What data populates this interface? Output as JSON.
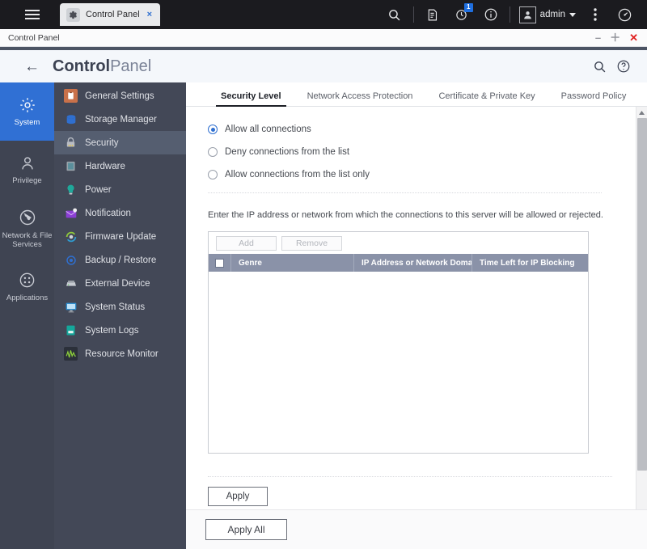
{
  "desktop": {
    "menu_icon": "hamburger-icon",
    "tab": {
      "icon": "gear-icon",
      "label": "Control Panel",
      "close": "×"
    },
    "toolbar": [
      {
        "name": "search-icon",
        "label": ""
      },
      {
        "name": "logs-icon",
        "label": ""
      },
      {
        "name": "update-sync-icon",
        "badge": "1"
      },
      {
        "name": "info-icon",
        "label": ""
      }
    ],
    "user": {
      "avatar": "user-avatar-icon",
      "name": "admin",
      "caret": "▾"
    },
    "more_icon": "vertical-dots-icon",
    "dashboard_icon": "speedometer-icon"
  },
  "window": {
    "title": "Control Panel",
    "minimize": "–",
    "maximize": "＋",
    "close": "✕"
  },
  "app_header": {
    "back": "←",
    "title_bold": "Control",
    "title_light": "Panel",
    "search_icon": "search-icon",
    "help_icon": "help-icon"
  },
  "rail": {
    "items": [
      {
        "label": "System",
        "icon": "gear-icon",
        "active": true
      },
      {
        "label": "Privilege",
        "icon": "user-icon",
        "active": false
      },
      {
        "label": "Network & File Services",
        "icon": "globe-icon",
        "active": false
      },
      {
        "label": "Applications",
        "icon": "grid-icon",
        "active": false
      }
    ]
  },
  "sidebar": {
    "items": [
      {
        "label": "General Settings",
        "icon": "clipboard-icon",
        "color": "#c9714a",
        "active": false
      },
      {
        "label": "Storage Manager",
        "icon": "database-icon",
        "color": "#2f6fd0",
        "active": false
      },
      {
        "label": "Security",
        "icon": "lock-icon",
        "color": "#b8bcc4",
        "active": true
      },
      {
        "label": "Hardware",
        "icon": "server-icon",
        "color": "#5a8f9c",
        "active": false
      },
      {
        "label": "Power",
        "icon": "power-bulb-icon",
        "color": "#1fa89a",
        "active": false
      },
      {
        "label": "Notification",
        "icon": "envelope-icon",
        "color": "#8b3fd4",
        "active": false
      },
      {
        "label": "Firmware Update",
        "icon": "refresh-icon",
        "color": "#2f9bd0",
        "active": false
      },
      {
        "label": "Backup / Restore",
        "icon": "backup-icon",
        "color": "#2f6fd0",
        "active": false
      },
      {
        "label": "External Device",
        "icon": "external-drive-icon",
        "color": "#9aa0a8",
        "active": false
      },
      {
        "label": "System Status",
        "icon": "monitor-icon",
        "color": "#2f8fd0",
        "active": false
      },
      {
        "label": "System Logs",
        "icon": "logs-doc-icon",
        "color": "#14a79b",
        "active": false
      },
      {
        "label": "Resource Monitor",
        "icon": "waveform-icon",
        "color": "#3a3f4b",
        "active": false
      }
    ]
  },
  "tabs": [
    {
      "label": "Security Level",
      "active": true
    },
    {
      "label": "Network Access Protection",
      "active": false
    },
    {
      "label": "Certificate & Private Key",
      "active": false
    },
    {
      "label": "Password Policy",
      "active": false
    }
  ],
  "security_level": {
    "options": [
      {
        "label": "Allow all connections",
        "checked": true
      },
      {
        "label": "Deny connections from the list",
        "checked": false
      },
      {
        "label": "Allow connections from the list only",
        "checked": false
      }
    ],
    "hint": "Enter the IP address or network from which the connections to this server will be allowed or rejected.",
    "table": {
      "add_label": "Add",
      "remove_label": "Remove",
      "columns": [
        "",
        "Genre",
        "IP Address or Network Doma..",
        "Time Left for IP Blocking"
      ],
      "rows": []
    },
    "apply_label": "Apply"
  },
  "footer": {
    "apply_all_label": "Apply All"
  },
  "colors": {
    "accent_blue": "#3070d4",
    "rail_bg": "#3f4452",
    "sidebar_bg": "#434857",
    "sidebar_active": "#555e70",
    "table_header": "#8a92a8",
    "close_red": "#e02020"
  }
}
